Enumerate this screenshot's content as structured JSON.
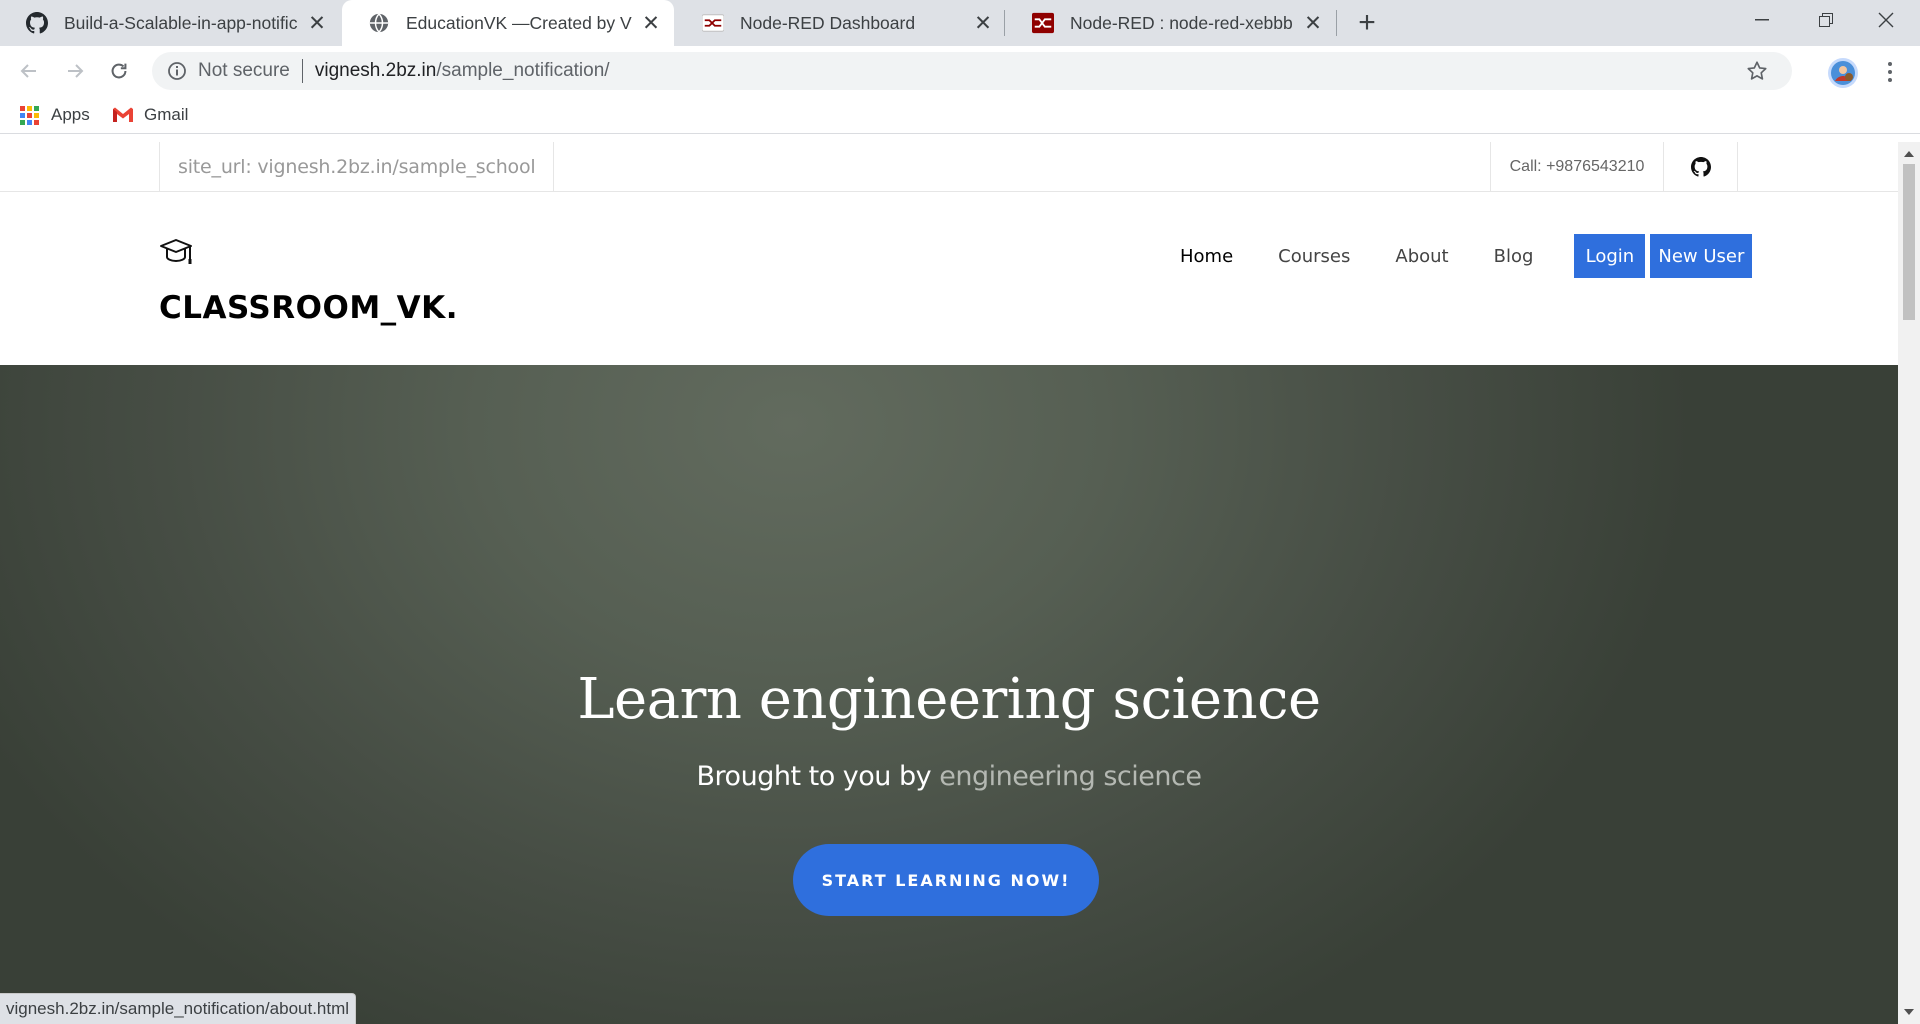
{
  "browser": {
    "tabs": [
      {
        "title": "Build-a-Scalable-in-app-notificati",
        "icon": "github-icon",
        "active": false
      },
      {
        "title": "EducationVK —Created by VIGNE",
        "icon": "globe-icon",
        "active": true
      },
      {
        "title": "Node-RED Dashboard",
        "icon": "node-red-icon",
        "active": false
      },
      {
        "title": "Node-RED : node-red-xebbb.eu-g",
        "icon": "node-red-icon",
        "active": false
      }
    ],
    "address_bar": {
      "security_label": "Not secure",
      "url_host": "vignesh.2bz.in",
      "url_path": "/sample_notification/"
    },
    "bookmarks": [
      {
        "label": "Apps",
        "icon": "apps-grid-icon"
      },
      {
        "label": "Gmail",
        "icon": "gmail-icon"
      }
    ],
    "status_bar": "vignesh.2bz.in/sample_notification/about.html"
  },
  "site": {
    "topbar": {
      "site_url": "site_url: vignesh.2bz.in/sample_school",
      "call": "Call: +9876543210"
    },
    "brand": "CLASSROOM_VK.",
    "nav": {
      "items": [
        "Home",
        "Courses",
        "About",
        "Blog"
      ],
      "login": "Login",
      "new_user": "New User"
    },
    "hero": {
      "title": "Learn engineering science",
      "subtitle_prefix": "Brought to you by",
      "subtitle_highlight": "engineering science",
      "cta": "START LEARNING NOW!"
    },
    "colors": {
      "accent": "#2f6fdd",
      "hero_bg": "#565f53"
    }
  }
}
